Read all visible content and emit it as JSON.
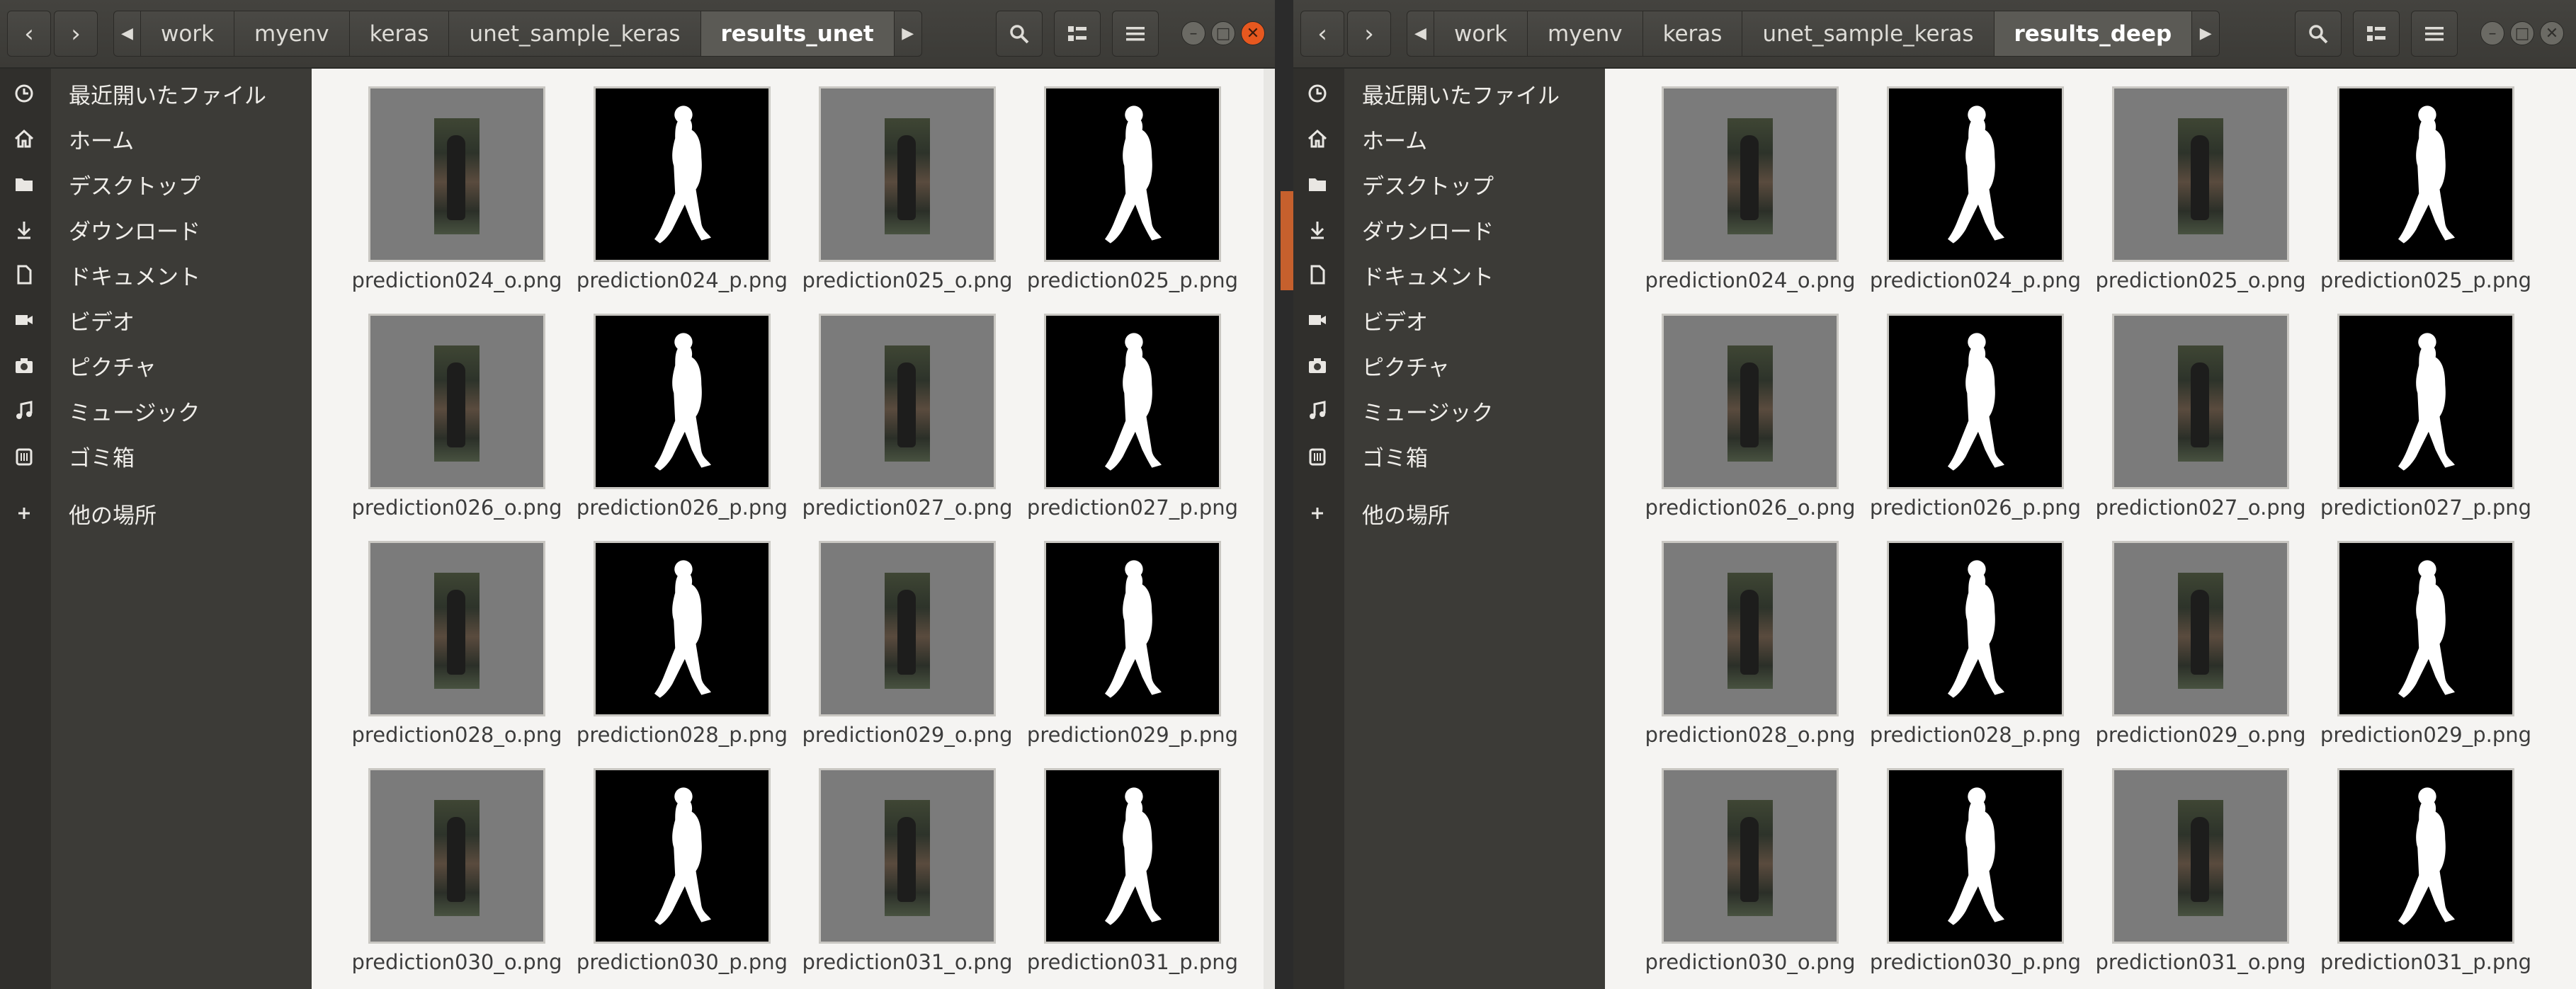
{
  "left_window": {
    "breadcrumbs": [
      "work",
      "myenv",
      "keras",
      "unet_sample_keras",
      "results_unet"
    ],
    "current_folder": "results_unet",
    "sidebar": {
      "items": [
        {
          "label": "最近開いたファイル",
          "icon": "clock-icon"
        },
        {
          "label": "ホーム",
          "icon": "home-icon"
        },
        {
          "label": "デスクトップ",
          "icon": "folder-icon"
        },
        {
          "label": "ダウンロード",
          "icon": "download-icon"
        },
        {
          "label": "ドキュメント",
          "icon": "document-icon"
        },
        {
          "label": "ビデオ",
          "icon": "video-icon"
        },
        {
          "label": "ピクチャ",
          "icon": "camera-icon"
        },
        {
          "label": "ミュージック",
          "icon": "music-icon"
        },
        {
          "label": "ゴミ箱",
          "icon": "trash-icon"
        },
        {
          "label": "他の場所",
          "icon": "plus-icon"
        }
      ]
    },
    "files": [
      "prediction024_o.png",
      "prediction024_p.png",
      "prediction025_o.png",
      "prediction025_p.png",
      "prediction026_o.png",
      "prediction026_p.png",
      "prediction027_o.png",
      "prediction027_p.png",
      "prediction028_o.png",
      "prediction028_p.png",
      "prediction029_o.png",
      "prediction029_p.png",
      "prediction030_o.png",
      "prediction030_p.png",
      "prediction031_o.png",
      "prediction031_p.png"
    ]
  },
  "right_window": {
    "breadcrumbs": [
      "work",
      "myenv",
      "keras",
      "unet_sample_keras",
      "results_deep"
    ],
    "current_folder": "results_deep",
    "sidebar": {
      "items": [
        {
          "label": "最近開いたファイル",
          "icon": "clock-icon"
        },
        {
          "label": "ホーム",
          "icon": "home-icon"
        },
        {
          "label": "デスクトップ",
          "icon": "folder-icon"
        },
        {
          "label": "ダウンロード",
          "icon": "download-icon"
        },
        {
          "label": "ドキュメント",
          "icon": "document-icon"
        },
        {
          "label": "ビデオ",
          "icon": "video-icon"
        },
        {
          "label": "ピクチャ",
          "icon": "camera-icon"
        },
        {
          "label": "ミュージック",
          "icon": "music-icon"
        },
        {
          "label": "ゴミ箱",
          "icon": "trash-icon"
        },
        {
          "label": "他の場所",
          "icon": "plus-icon"
        }
      ]
    },
    "files": [
      "prediction024_o.png",
      "prediction024_p.png",
      "prediction025_o.png",
      "prediction025_p.png",
      "prediction026_o.png",
      "prediction026_p.png",
      "prediction027_o.png",
      "prediction027_p.png",
      "prediction028_o.png",
      "prediction028_p.png",
      "prediction029_o.png",
      "prediction029_p.png",
      "prediction030_o.png",
      "prediction030_p.png",
      "prediction031_o.png",
      "prediction031_p.png"
    ]
  },
  "colors": {
    "header": "#3d3c38",
    "sidebar": "#3c3b37",
    "content": "#f5f4f2",
    "close_button": "#e7581f",
    "thumb_gray": "#7b7b7b"
  }
}
